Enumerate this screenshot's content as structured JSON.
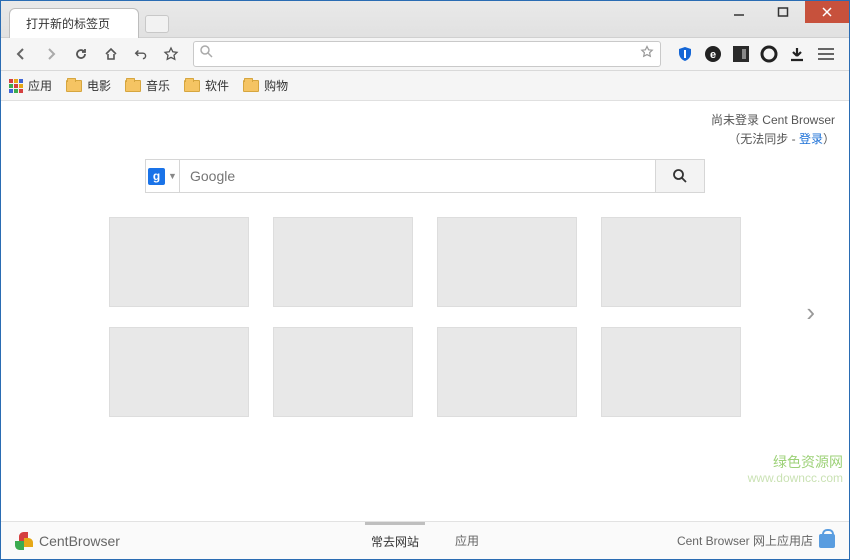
{
  "tab": {
    "title": "打开新的标签页"
  },
  "bookmarks": {
    "apps": "应用",
    "items": [
      "电影",
      "音乐",
      "软件",
      "购物"
    ]
  },
  "signin": {
    "line1": "尚未登录 Cent Browser",
    "prefix": "（无法同步 - ",
    "link": "登录",
    "suffix": "）"
  },
  "search": {
    "placeholder": "Google"
  },
  "footer": {
    "brand": "CentBrowser",
    "tab_frequent": "常去网站",
    "tab_apps": "应用",
    "store": "Cent Browser 网上应用店"
  },
  "watermark": {
    "text": "绿色资源网",
    "url": "www.downcc.com"
  }
}
